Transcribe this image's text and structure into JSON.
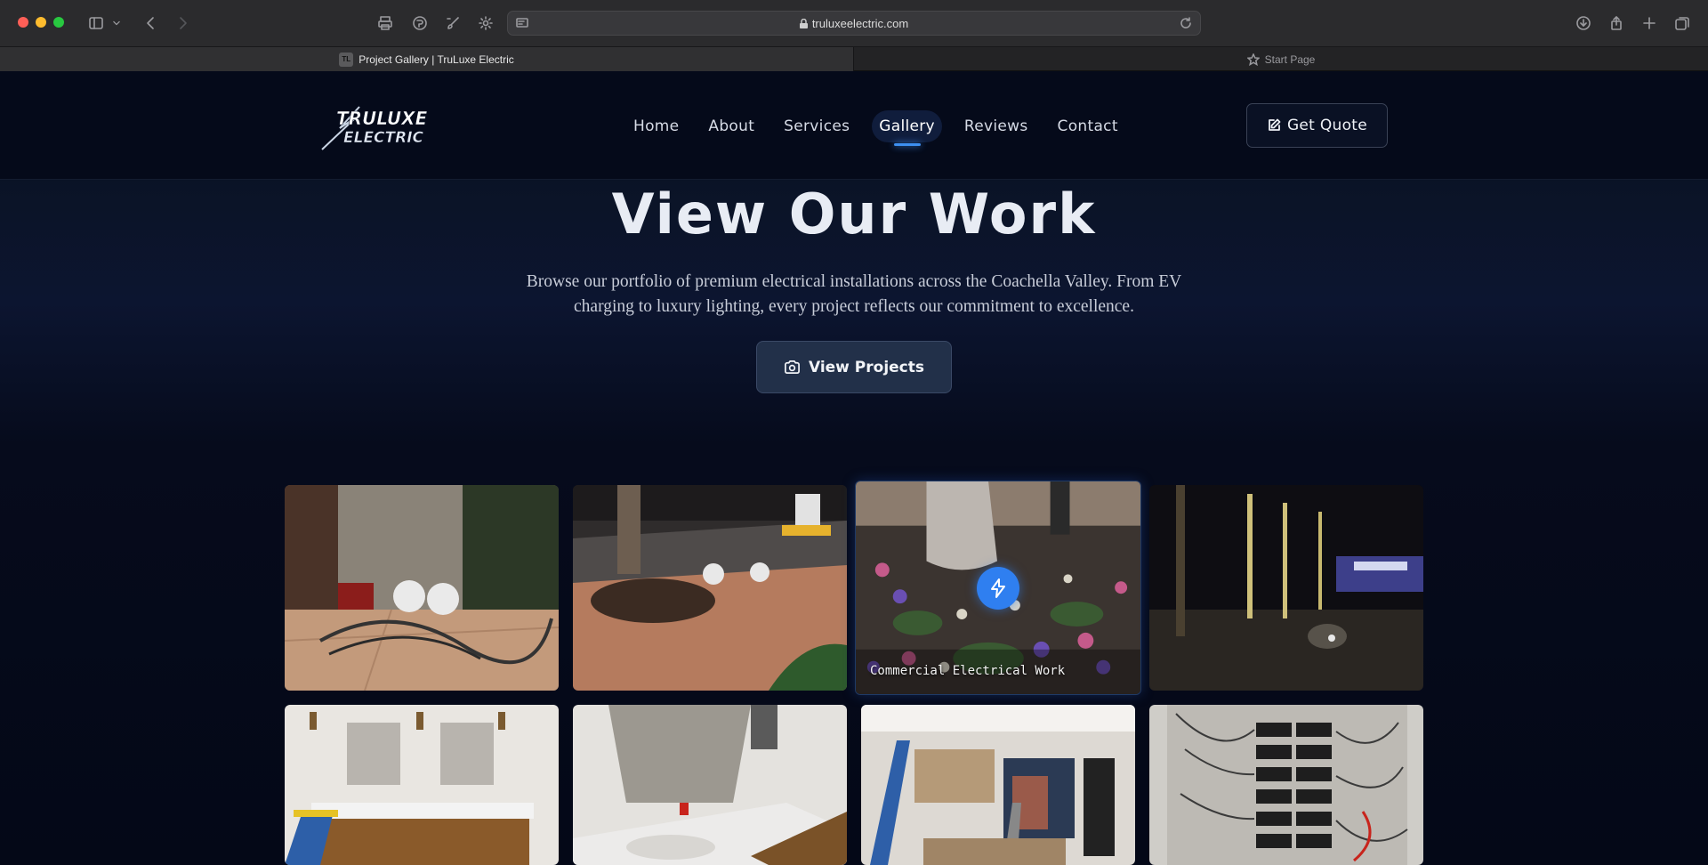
{
  "browser": {
    "url": "truluxeelectric.com",
    "tabs": [
      {
        "title": "Project Gallery | TruLuxe Electric",
        "favicon": "TL"
      },
      {
        "title": "Start Page"
      }
    ]
  },
  "site": {
    "logo_text_1": "TRULUXE",
    "logo_text_2": "ELECTRIC",
    "nav": [
      "Home",
      "About",
      "Services",
      "Gallery",
      "Reviews",
      "Contact"
    ],
    "active_nav": "Gallery",
    "quote_label": "Get Quote"
  },
  "hero": {
    "title": "View Our Work",
    "subtitle": "Browse our portfolio of premium electrical installations across the Coachella Valley. From EV charging to luxury lighting, every project reflects our commitment to excellence.",
    "button_label": "View Projects"
  },
  "gallery": {
    "hover_caption": "Commercial Electrical Work",
    "photos": [
      "storefront-work-site",
      "palm-tree-night-trench",
      "palm-tree-flowerbed",
      "night-landscape-lighting",
      "double-vanity-bathroom",
      "vanity-bathroom-mirror",
      "kitchen-remodel-ladder",
      "electrical-panel-wiring"
    ]
  }
}
